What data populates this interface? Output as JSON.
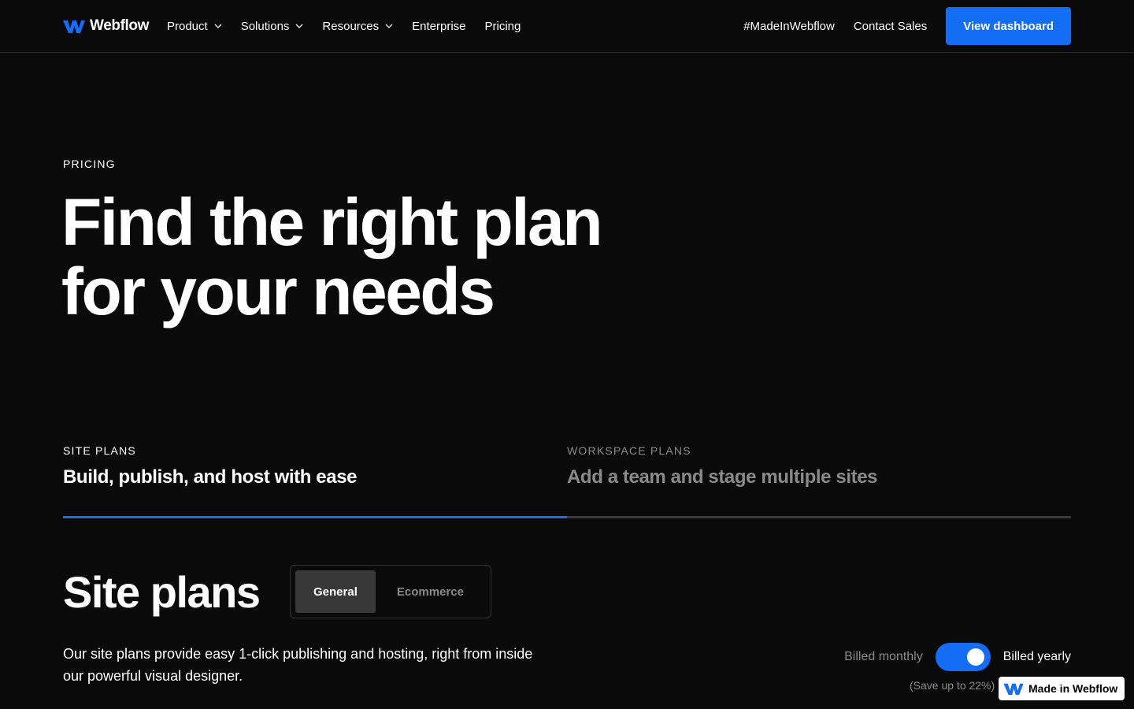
{
  "nav": {
    "logo_text": "Webflow",
    "items": [
      {
        "label": "Product",
        "dropdown": true
      },
      {
        "label": "Solutions",
        "dropdown": true
      },
      {
        "label": "Resources",
        "dropdown": true
      },
      {
        "label": "Enterprise",
        "dropdown": false
      },
      {
        "label": "Pricing",
        "dropdown": false
      }
    ],
    "right_links": [
      "#MadeInWebflow",
      "Contact Sales"
    ],
    "cta_label": "View dashboard"
  },
  "hero": {
    "eyebrow": "PRICING",
    "title_line1": "Find the right plan",
    "title_line2": "for your needs"
  },
  "plan_tabs": [
    {
      "eyebrow": "SITE PLANS",
      "subtitle": "Build, publish, and host with ease",
      "active": true
    },
    {
      "eyebrow": "WORKSPACE PLANS",
      "subtitle": "Add a team and stage multiple sites",
      "active": false
    }
  ],
  "site_plans": {
    "title": "Site plans",
    "segments": [
      {
        "label": "General",
        "active": true
      },
      {
        "label": "Ecommerce",
        "active": false
      }
    ],
    "description": "Our site plans provide easy 1-click publishing and hosting, right from inside our powerful visual designer."
  },
  "billing": {
    "monthly_label": "Billed monthly",
    "yearly_label": "Billed yearly",
    "yearly_selected": true,
    "save_note": "(Save up to 22%)"
  },
  "badge": {
    "label": "Made in Webflow"
  },
  "colors": {
    "accent": "#146ef5",
    "background": "#0a0a0a",
    "muted_text": "#8a8a8a"
  }
}
